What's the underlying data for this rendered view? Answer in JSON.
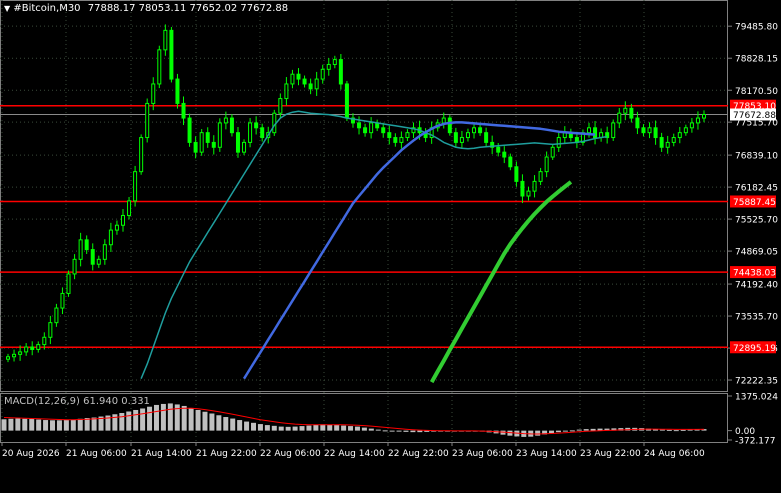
{
  "header": {
    "dropdown_icon": "triangle-down-icon",
    "symbol": "#Bitcoin,M30",
    "ohlc": "77888.17 78053.11 77652.02 77672.88"
  },
  "colors": {
    "background": "#000000",
    "grid": "#3a4a3a",
    "candle": "#00ff00",
    "level_line": "#ff0000",
    "ma_fast": "#1f9e9e",
    "ma_mid": "#4169e1",
    "ma_slow": "#32cd32",
    "macd_hist": "#c0c0c0",
    "macd_signal": "#ff0000",
    "axis_text": "#ffffff"
  },
  "chart_data": [
    {
      "type": "candlestick",
      "title": "#Bitcoin,M30",
      "ylim": [
        72100,
        79900
      ],
      "y_ticks": [
        "79485.80",
        "78828.15",
        "78170.50",
        "77515.70",
        "76839.10",
        "76182.45",
        "75525.70",
        "74869.05",
        "74192.40",
        "73535.70",
        "72879.05",
        "72222.35"
      ],
      "x_ticks": [
        "20 Aug 2026",
        "21 Aug 06:00",
        "21 Aug 14:00",
        "21 Aug 22:00",
        "22 Aug 06:00",
        "22 Aug 14:00",
        "22 Aug 22:00",
        "23 Aug 06:00",
        "23 Aug 14:00",
        "23 Aug 22:00",
        "24 Aug 06:00"
      ],
      "current_price": "77672.88",
      "horizontal_levels": [
        {
          "value": 77853.1,
          "label": "77853.10"
        },
        {
          "value": 75887.45,
          "label": "75887.45"
        },
        {
          "value": 74438.03,
          "label": "74438.03"
        },
        {
          "value": 72895.19,
          "label": "72895.19"
        }
      ],
      "close": [
        72700,
        72750,
        72800,
        72900,
        72850,
        72950,
        73100,
        73400,
        73700,
        74000,
        74400,
        74700,
        75100,
        74900,
        74600,
        74700,
        75000,
        75300,
        75400,
        75600,
        75900,
        76500,
        77200,
        77900,
        78300,
        79000,
        79400,
        78400,
        77900,
        77600,
        77100,
        76900,
        77300,
        77100,
        77000,
        77500,
        77600,
        77300,
        76900,
        77100,
        77500,
        77400,
        77200,
        77300,
        77700,
        78000,
        78300,
        78500,
        78400,
        78300,
        78200,
        78400,
        78600,
        78700,
        78800,
        78300,
        77600,
        77500,
        77400,
        77300,
        77500,
        77400,
        77300,
        77200,
        77100,
        77200,
        77300,
        77400,
        77300,
        77200,
        77400,
        77500,
        77600,
        77300,
        77100,
        77200,
        77300,
        77400,
        77300,
        77100,
        77000,
        76900,
        76800,
        76600,
        76300,
        76000,
        76100,
        76300,
        76500,
        76800,
        77000,
        77200,
        77300,
        77200,
        77100,
        77300,
        77400,
        77200,
        77300,
        77200,
        77500,
        77700,
        77800,
        77600,
        77400,
        77300,
        77400,
        77200,
        77000,
        77100,
        77200,
        77300,
        77400,
        77500,
        77600,
        77673
      ],
      "series": [
        {
          "name": "MA fast",
          "color": "#1f9e9e",
          "values": [
            null,
            null,
            null,
            null,
            null,
            null,
            null,
            null,
            null,
            null,
            null,
            null,
            null,
            null,
            null,
            null,
            null,
            null,
            null,
            null,
            null,
            null,
            72250,
            72550,
            72900,
            73250,
            73600,
            73900,
            74150,
            74400,
            74650,
            74850,
            75050,
            75250,
            75450,
            75650,
            75850,
            76050,
            76250,
            76450,
            76650,
            76850,
            77050,
            77250,
            77450,
            77600,
            77680,
            77720,
            77740,
            77720,
            77700,
            77690,
            77680,
            77670,
            77650,
            77630,
            77600,
            77580,
            77560,
            77540,
            77520,
            77500,
            77480,
            77460,
            77440,
            77420,
            77400,
            77380,
            77350,
            77300,
            77250,
            77180,
            77100,
            77050,
            77000,
            76980,
            76970,
            76980,
            77000,
            77010,
            77020,
            77030,
            77040,
            77050,
            77060,
            77070,
            77080,
            77090,
            77080,
            77070,
            77060,
            77070,
            77080,
            77090,
            77100,
            77120,
            77150,
            77180,
            77200,
            77220
          ]
        },
        {
          "name": "MA mid",
          "color": "#4169e1",
          "values": [
            null,
            null,
            null,
            null,
            null,
            null,
            null,
            null,
            null,
            null,
            null,
            null,
            null,
            null,
            null,
            null,
            null,
            null,
            null,
            null,
            null,
            null,
            null,
            null,
            null,
            null,
            null,
            null,
            null,
            null,
            null,
            null,
            null,
            null,
            null,
            null,
            null,
            null,
            null,
            72250,
            72450,
            72650,
            72850,
            73050,
            73250,
            73450,
            73650,
            73850,
            74050,
            74250,
            74450,
            74650,
            74850,
            75050,
            75250,
            75450,
            75650,
            75850,
            76000,
            76150,
            76300,
            76450,
            76580,
            76700,
            76820,
            76940,
            77040,
            77140,
            77230,
            77310,
            77380,
            77440,
            77480,
            77500,
            77510,
            77510,
            77500,
            77490,
            77480,
            77470,
            77460,
            77450,
            77440,
            77430,
            77420,
            77410,
            77400,
            77390,
            77380,
            77360,
            77340,
            77320,
            77310,
            77300,
            77290,
            77280,
            77270,
            77260
          ]
        },
        {
          "name": "MA slow",
          "color": "#32cd32",
          "values": [
            null,
            null,
            null,
            null,
            null,
            null,
            null,
            null,
            null,
            null,
            null,
            null,
            null,
            null,
            null,
            null,
            null,
            null,
            null,
            null,
            null,
            null,
            null,
            null,
            null,
            null,
            null,
            null,
            null,
            null,
            null,
            null,
            null,
            null,
            null,
            null,
            null,
            null,
            null,
            null,
            null,
            null,
            null,
            null,
            null,
            null,
            null,
            null,
            null,
            null,
            null,
            null,
            null,
            null,
            null,
            null,
            null,
            null,
            null,
            null,
            null,
            null,
            null,
            null,
            null,
            null,
            null,
            null,
            null,
            null,
            72180,
            72400,
            72620,
            72840,
            73060,
            73280,
            73500,
            73720,
            73940,
            74160,
            74380,
            74600,
            74820,
            75010,
            75180,
            75340,
            75490,
            75630,
            75760,
            75880,
            75990,
            76090,
            76190,
            76290
          ]
        }
      ]
    },
    {
      "type": "bar",
      "title": "MACD(12,26,9) 61.940 0.331",
      "ylim": [
        -372.177,
        1375.024
      ],
      "y_ticks": [
        "1375.024",
        "0.00",
        "-372.177"
      ],
      "series": [
        {
          "name": "MACD",
          "color": "#c0c0c0",
          "values": [
            450,
            470,
            480,
            470,
            460,
            440,
            420,
            410,
            410,
            420,
            440,
            470,
            500,
            520,
            560,
            600,
            650,
            700,
            760,
            820,
            880,
            950,
            1020,
            1060,
            1080,
            1040,
            980,
            900,
            820,
            750,
            680,
            610,
            540,
            480,
            420,
            360,
            310,
            260,
            220,
            190,
            160,
            150,
            160,
            180,
            200,
            230,
            250,
            240,
            220,
            200,
            180,
            160,
            120,
            80,
            40,
            10,
            -20,
            -40,
            -50,
            -60,
            -60,
            -50,
            -40,
            -30,
            -20,
            -10,
            0,
            -10,
            -20,
            -40,
            -70,
            -110,
            -160,
            -200,
            -230,
            -250,
            -240,
            -200,
            -150,
            -100,
            -60,
            -20,
            10,
            40,
            60,
            70,
            80,
            80,
            90,
            100,
            110,
            110,
            100,
            80,
            60,
            40,
            30,
            20,
            30,
            40,
            50,
            60
          ]
        },
        {
          "name": "Signal",
          "color": "#ff0000",
          "values": [
            520,
            510,
            500,
            490,
            480,
            470,
            460,
            450,
            440,
            435,
            435,
            440,
            450,
            465,
            480,
            500,
            525,
            555,
            590,
            630,
            670,
            715,
            760,
            805,
            845,
            875,
            890,
            885,
            865,
            835,
            795,
            750,
            700,
            650,
            595,
            540,
            485,
            435,
            390,
            350,
            315,
            285,
            260,
            245,
            235,
            230,
            232,
            235,
            235,
            232,
            225,
            215,
            200,
            180,
            155,
            130,
            105,
            80,
            55,
            35,
            20,
            8,
            0,
            -5,
            -8,
            -10,
            -10,
            -10,
            -12,
            -18,
            -28,
            -42,
            -60,
            -80,
            -100,
            -118,
            -130,
            -132,
            -126,
            -115,
            -100,
            -83,
            -64,
            -45,
            -28,
            -14,
            -2,
            8,
            18,
            28,
            38,
            48,
            56,
            60,
            60,
            58,
            54,
            50,
            48,
            48,
            50,
            53
          ]
        }
      ]
    }
  ]
}
